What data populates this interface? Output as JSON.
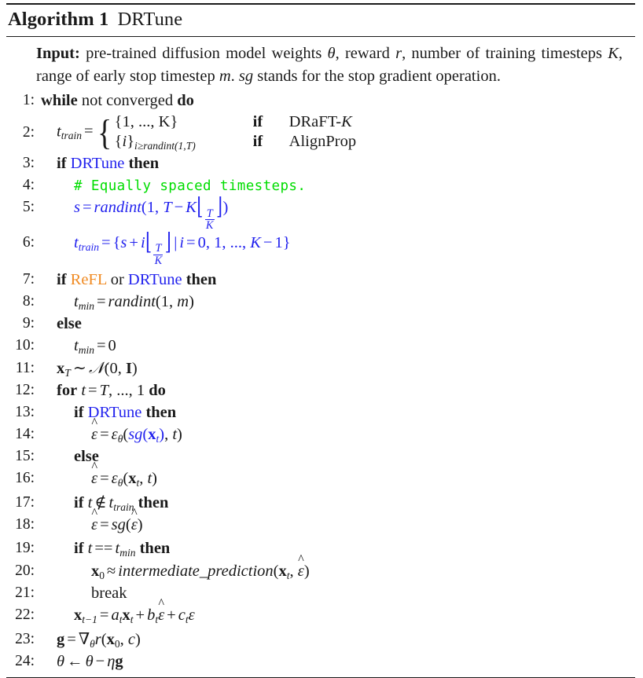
{
  "algorithm": {
    "caption_label": "Algorithm",
    "caption_number": "1",
    "caption_name": "DRTune",
    "colors": {
      "drtune_blue": "#2222ee",
      "refl_orange": "#f08a22",
      "comment_green": "#00dd00",
      "text": "#1a1a1a"
    },
    "input": {
      "label": "Input:",
      "text_1": "pre-trained diffusion model weights",
      "sym_theta": "θ",
      "text_2": ", reward",
      "sym_r": "r",
      "text_3": ", number of training timesteps",
      "sym_K": "K",
      "text_4": ", range of early stop timestep",
      "sym_m": "m",
      "text_5": ".",
      "sym_sg": "sg",
      "text_6": "stands for the stop gradient operation."
    },
    "lines": [
      {
        "num": "1:",
        "text": "while not converged do"
      },
      {
        "num": "2:",
        "text": "t_train = { {1, ..., K} if DRaFT-K ; {i}_{i>=randint(1,T)} if AlignProp"
      },
      {
        "num": "3:",
        "text": "if DRTune then"
      },
      {
        "num": "4:",
        "text": "# Equally spaced timesteps."
      },
      {
        "num": "5:",
        "text": "s = randint(1, T - K floor(T/K))"
      },
      {
        "num": "6:",
        "text": "t_train = {s + i floor(T/K) | i = 0, 1, ..., K - 1}"
      },
      {
        "num": "7:",
        "text": "if ReFL or DRTune then"
      },
      {
        "num": "8:",
        "text": "t_min = randint(1, m)"
      },
      {
        "num": "9:",
        "text": "else"
      },
      {
        "num": "10:",
        "text": "t_min = 0"
      },
      {
        "num": "11:",
        "text": "x_T ~ N(0, I)"
      },
      {
        "num": "12:",
        "text": "for t = T, ..., 1 do"
      },
      {
        "num": "13:",
        "text": "if DRTune then"
      },
      {
        "num": "14:",
        "text": "eps_hat = eps_theta(sg(x_t), t)"
      },
      {
        "num": "15:",
        "text": "else"
      },
      {
        "num": "16:",
        "text": "eps_hat = eps_theta(x_t, t)"
      },
      {
        "num": "17:",
        "text": "if t not-in t_train then"
      },
      {
        "num": "18:",
        "text": "eps_hat = sg(eps_hat)"
      },
      {
        "num": "19:",
        "text": "if t == t_min then"
      },
      {
        "num": "20:",
        "text": "x_0 ~~ intermediate_prediction(x_t, eps_hat)"
      },
      {
        "num": "21:",
        "text": "break"
      },
      {
        "num": "22:",
        "text": "x_{t-1} = a_t x_t + b_t eps_hat + c_t eps"
      },
      {
        "num": "23:",
        "text": "g = grad_theta r(x_0, c)"
      },
      {
        "num": "24:",
        "text": "theta <- theta - eta g"
      }
    ],
    "tokens": {
      "while": "while",
      "not_converged": "not converged",
      "do": "do",
      "if": "if",
      "then": "then",
      "else": "else",
      "for": "for",
      "break": "break",
      "or": "or",
      "drtune": "DRTune",
      "refl": "ReFL",
      "draft": "DRaFT-",
      "alignprop": "AlignProp",
      "comment_4": "# Equally spaced timesteps.",
      "randint": "randint",
      "sg": "sg",
      "intermediate_prediction": "intermediate_prediction"
    },
    "numbers": {
      "n1": "1:",
      "n2": "2:",
      "n3": "3:",
      "n4": "4:",
      "n5": "5:",
      "n6": "6:",
      "n7": "7:",
      "n8": "8:",
      "n9": "9:",
      "n10": "10:",
      "n11": "11:",
      "n12": "12:",
      "n13": "13:",
      "n14": "14:",
      "n15": "15:",
      "n16": "16:",
      "n17": "17:",
      "n18": "18:",
      "n19": "19:",
      "n20": "20:",
      "n21": "21:",
      "n22": "22:",
      "n23": "23:",
      "n24": "24:"
    }
  }
}
